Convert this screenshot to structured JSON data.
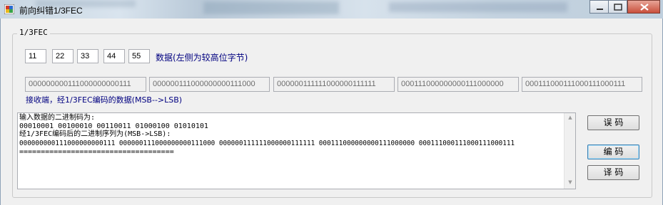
{
  "window": {
    "title": "前向纠错1/3FEC"
  },
  "group": {
    "label": "1/3FEC"
  },
  "inputs": {
    "bytes": [
      "11",
      "22",
      "33",
      "44",
      "55"
    ],
    "hint": "数据(左侧为较高位字节)"
  },
  "codes": {
    "values": [
      "000000000111000000000111",
      "000000111000000000111000",
      "000000111111000000111111",
      "000111000000000111000000",
      "000111000111000111000111"
    ],
    "label": "接收端，经1/3FEC编码的数据(MSB-->LSB)"
  },
  "output": {
    "lines": [
      "输入数据的二进制码为:",
      "00010001 00100010 00110011 01000100 01010101",
      "经1/3FEC编码后的二进制序列为(MSB->LSB):",
      "000000000111000000000111 000000111000000000111000 000000111111000000111111 000111000000000111000000 000111000111000111000111",
      "===================================="
    ]
  },
  "buttons": {
    "error": "误 码",
    "encode": "编 码",
    "decode": "译 码"
  }
}
